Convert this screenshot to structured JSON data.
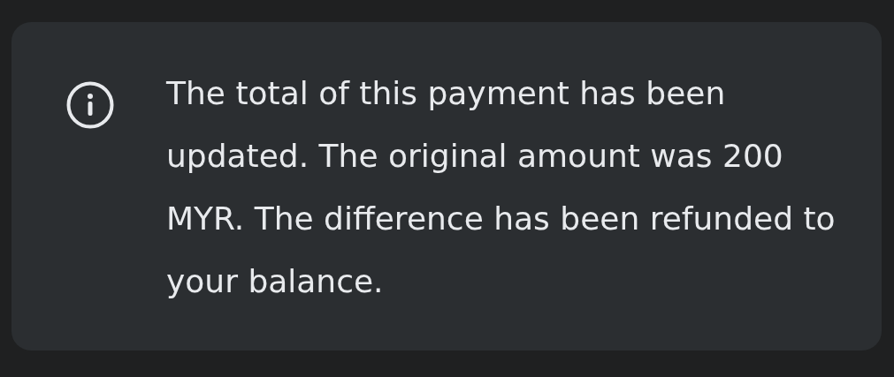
{
  "notice": {
    "message": "The total of this payment has been updated. The original amount was 200 MYR. The difference has been refunded to your balance."
  }
}
